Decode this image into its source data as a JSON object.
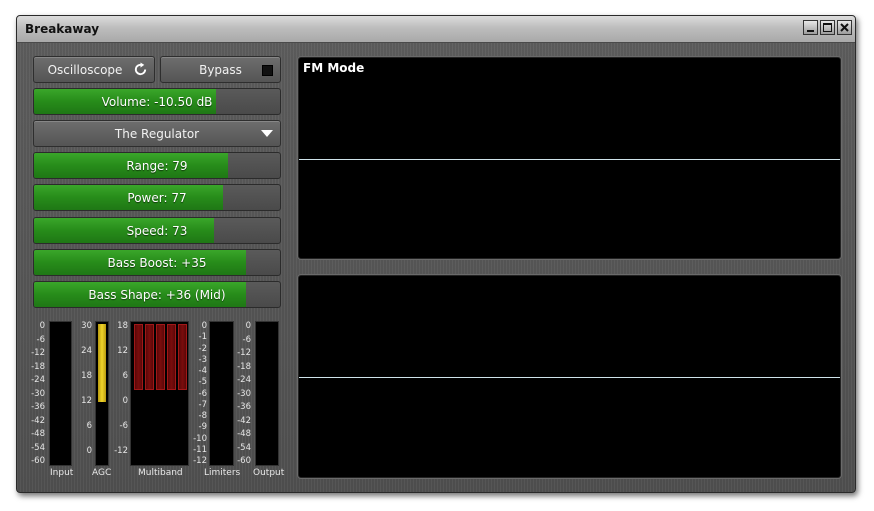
{
  "window": {
    "title": "Breakaway"
  },
  "titlebar_buttons": [
    "minimize-icon",
    "maximize-icon",
    "close-icon"
  ],
  "controls": {
    "oscilloscope_label": "Oscilloscope",
    "bypass_label": "Bypass",
    "preset_label": "The Regulator"
  },
  "sliders": [
    {
      "label": "Volume: -10.50 dB",
      "level_pct": 74
    },
    {
      "label": "Range: 79",
      "level_pct": 79
    },
    {
      "label": "Power: 77",
      "level_pct": 77
    },
    {
      "label": "Speed: 73",
      "level_pct": 73
    },
    {
      "label": "Bass Boost: +35",
      "level_pct": 86
    },
    {
      "label": "Bass Shape: +36 (Mid)",
      "level_pct": 86
    }
  ],
  "meters": {
    "input_scale": [
      "0",
      "-6",
      "-12",
      "-18",
      "-24",
      "-30",
      "-36",
      "-42",
      "-48",
      "-54",
      "-60"
    ],
    "agc_scale": [
      "30",
      "24",
      "18",
      "12",
      "6",
      "0"
    ],
    "multiband_scale": [
      "18",
      "12",
      "6",
      "0",
      "-6",
      "-12"
    ],
    "limiters_scale": [
      "0",
      "-1",
      "-2",
      "-3",
      "-4",
      "-5",
      "-6",
      "-7",
      "-8",
      "-9",
      "-10",
      "-11",
      "-12"
    ],
    "output_scale": [
      "0",
      "-6",
      "-12",
      "-18",
      "-24",
      "-30",
      "-36",
      "-42",
      "-48",
      "-54",
      "-60"
    ],
    "labels": {
      "input": "Input",
      "agc": "AGC",
      "multiband": "Multiband",
      "limiters": "Limiters",
      "output": "Output"
    },
    "agc_level": 0.55,
    "multiband_bands": 5,
    "multiband_level": 0.47
  },
  "scope": {
    "top_title": "FM Mode"
  },
  "colors": {
    "accent_green": "#2a961e",
    "agc_yellow": "#e0c21a",
    "multiband_red": "#7a0c0c"
  }
}
